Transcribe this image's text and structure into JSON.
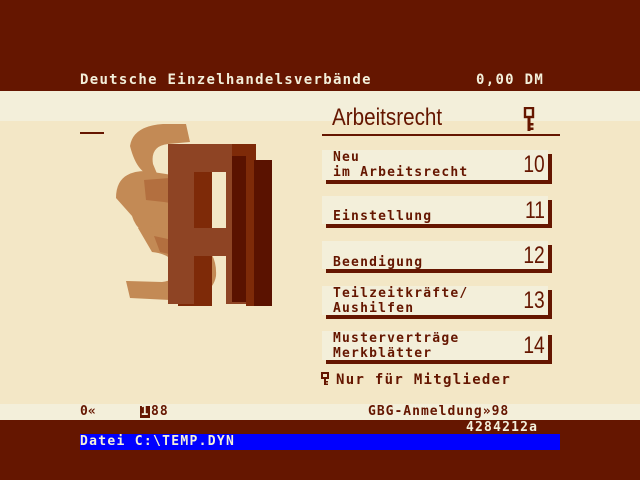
{
  "header": {
    "provider": "Deutsche Einzelhandelsverbände",
    "price": "0,00 DM"
  },
  "page": {
    "title": "Arbeitsrecht",
    "header_icon": "key-icon"
  },
  "menu": [
    {
      "label": "Neu\nim Arbeitsrecht",
      "number": "10"
    },
    {
      "label": "Einstellung",
      "number": "11"
    },
    {
      "label": "Beendigung",
      "number": "12"
    },
    {
      "label": "Teilzeitkräfte/\nAushilfen",
      "number": "13"
    },
    {
      "label": "Musterverträge\nMerkblätter",
      "number": "14"
    }
  ],
  "members_note": "Nur für Mitglieder",
  "footer": {
    "back": "0«",
    "page_box": "1",
    "page_num": "88",
    "gbg": "GBG-Anmeldung»98",
    "page_code": "4284212a"
  },
  "status": {
    "text": "Datei C:\\TEMP.DYN"
  },
  "colors": {
    "dark": "#651600",
    "cream": "#F3EFDA",
    "beige": "#F3E7C6",
    "tan": "#C38A55",
    "status_blue": "#0000FF"
  }
}
